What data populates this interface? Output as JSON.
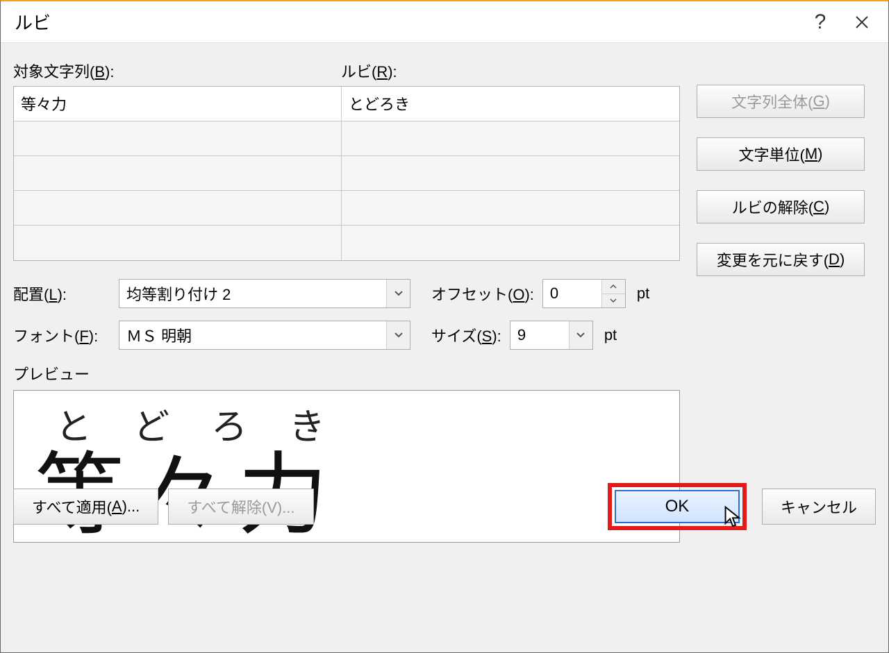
{
  "titlebar": {
    "title": "ルビ"
  },
  "labels": {
    "base": "対象文字列(B):",
    "ruby": "ルビ(R):",
    "align": "配置(L):",
    "offset": "オフセット(O):",
    "font": "フォント(F):",
    "size": "サイズ(S):",
    "preview": "プレビュー",
    "pt": "pt"
  },
  "rows": [
    {
      "base": "等々力",
      "ruby": "とどろき"
    },
    {
      "base": "",
      "ruby": ""
    },
    {
      "base": "",
      "ruby": ""
    },
    {
      "base": "",
      "ruby": ""
    },
    {
      "base": "",
      "ruby": ""
    }
  ],
  "side": {
    "whole": "文字列全体(G)",
    "mono": "文字単位(M)",
    "clear": "ルビの解除(C)",
    "reset": "変更を元に戻す(D)"
  },
  "form": {
    "align": "均等割り付け 2",
    "offset": "0",
    "font": "ＭＳ 明朝",
    "size": "9"
  },
  "preview": {
    "ruby": "とどろき",
    "base": "等々力"
  },
  "bottom": {
    "applyAll": "すべて適用(A)...",
    "clearAll": "すべて解除(V)...",
    "ok": "OK",
    "cancel": "キャンセル"
  }
}
